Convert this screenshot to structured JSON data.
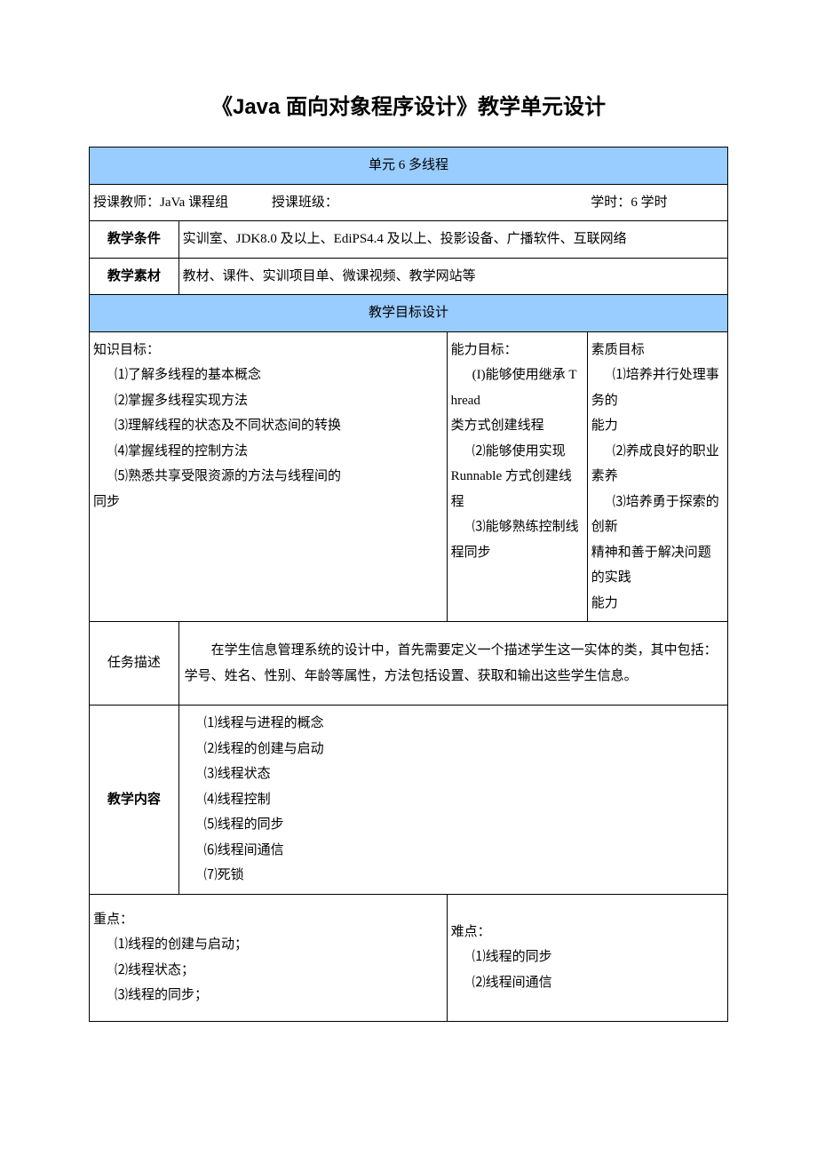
{
  "title": "《Java 面向对象程序设计》教学单元设计",
  "unitHeader": "单元 6 多线程",
  "info": {
    "teacherLabel": "授课教师：",
    "teacherValue": "JaVa 课程组",
    "classLabel": "授课班级：",
    "classValue": "",
    "hoursLabel": "学时：",
    "hoursValue": "6 学时"
  },
  "cond": {
    "label": "教学条件",
    "value": "实训室、JDK8.0 及以上、EdiPS4.4 及以上、投影设备、广播软件、互联网络"
  },
  "mat": {
    "label": "教学素材",
    "value": "教材、课件、实训项目单、微课视频、教学网站等"
  },
  "goalsHeader": "教学目标设计",
  "goals": {
    "knowledge": {
      "title": "知识目标：",
      "items": [
        "⑴了解多线程的基本概念",
        "⑵掌握多线程实现方法",
        "⑶理解线程的状态及不同状态间的转换",
        "⑷掌握线程的控制方法",
        "⑸熟悉共享受限资源的方法与线程间的"
      ],
      "tail": "同步"
    },
    "ability": {
      "title": "能力目标：",
      "l1": "(I)能够使用继承 Thread",
      "l2": "类方式创建线程",
      "l3": "⑵能够使用实现",
      "l4": "Runnable 方式创建线程",
      "l5": "⑶能够熟练控制线程同步"
    },
    "quality": {
      "title": "素质目标",
      "l1": "⑴培养并行处理事务的",
      "l2": "能力",
      "l3": "⑵养成良好的职业素养",
      "l4": "⑶培养勇于探索的创新",
      "l5": "精神和善于解决问题的实践",
      "l6": "能力"
    }
  },
  "task": {
    "label": "任务描述",
    "value": "在学生信息管理系统的设计中，首先需要定义一个描述学生这一实体的类，其中包括：学号、姓名、性别、年龄等属性，方法包括设置、获取和输出这些学生信息。"
  },
  "content": {
    "label": "教学内容",
    "items": [
      "⑴线程与进程的概念",
      "⑵线程的创建与启动",
      "⑶线程状态",
      "⑷线程控制",
      "⑸线程的同步",
      "⑹线程间通信",
      "⑺死锁"
    ]
  },
  "keypoints": {
    "title": "重点：",
    "items": [
      "⑴线程的创建与启动；",
      "⑵线程状态；",
      "⑶线程的同步；"
    ]
  },
  "diffpoints": {
    "title": "难点：",
    "items": [
      "⑴线程的同步",
      "⑵线程间通信"
    ]
  }
}
